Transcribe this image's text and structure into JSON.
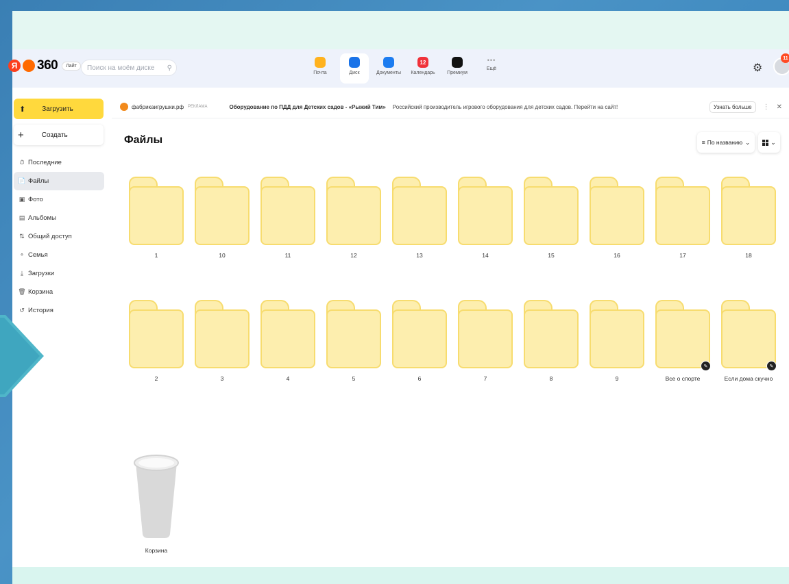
{
  "header": {
    "logo_ya": "Я",
    "logo_360": "360",
    "logo_lite": "Лайт",
    "search_placeholder": "Поиск на моём диске",
    "services": [
      {
        "label": "Почта",
        "color": "#ffb21e",
        "icon": "mail-icon"
      },
      {
        "label": "Диск",
        "color": "#1a73e8",
        "icon": "disk-icon",
        "active": true
      },
      {
        "label": "Документы",
        "color": "#1c7cf0",
        "icon": "docs-icon"
      },
      {
        "label": "Календарь",
        "color": "#f0323a",
        "icon": "calendar-icon",
        "badge": "12"
      },
      {
        "label": "Премиум",
        "color": "#111111",
        "icon": "premium-icon"
      },
      {
        "label": "Ещё",
        "color": "",
        "icon": "more-icon"
      }
    ],
    "notifications": "11"
  },
  "sidebar": {
    "upload_label": "Загрузить",
    "create_label": "Создать",
    "items": [
      {
        "label": "Последние",
        "icon": "clock-icon"
      },
      {
        "label": "Файлы",
        "icon": "file-icon",
        "active": true
      },
      {
        "label": "Фото",
        "icon": "photo-icon"
      },
      {
        "label": "Альбомы",
        "icon": "album-icon"
      },
      {
        "label": "Общий доступ",
        "icon": "share-icon"
      },
      {
        "label": "Семья",
        "icon": "family-icon"
      },
      {
        "label": "Загрузки",
        "icon": "download-icon"
      },
      {
        "label": "Корзина",
        "icon": "trash-icon"
      },
      {
        "label": "История",
        "icon": "history-icon"
      }
    ]
  },
  "ad": {
    "domain": "фабрикаигрушки.рф",
    "tag": "РЕКЛАМА",
    "title": "Оборудование по ПДД для Детских садов - «Рыжий Тим»",
    "text": "Российский производитель игрового оборудования для детских садов. Перейти на сайт!",
    "more_label": "Узнать больше"
  },
  "main": {
    "title": "Файлы",
    "sort_label": "По названию",
    "folders": [
      {
        "name": "1"
      },
      {
        "name": "10"
      },
      {
        "name": "11"
      },
      {
        "name": "12"
      },
      {
        "name": "13"
      },
      {
        "name": "14"
      },
      {
        "name": "15"
      },
      {
        "name": "16"
      },
      {
        "name": "17"
      },
      {
        "name": "18"
      },
      {
        "name": "2"
      },
      {
        "name": "3"
      },
      {
        "name": "4"
      },
      {
        "name": "5"
      },
      {
        "name": "6"
      },
      {
        "name": "7"
      },
      {
        "name": "8"
      },
      {
        "name": "9"
      },
      {
        "name": "Все о спорте",
        "shared": true
      },
      {
        "name": "Если дома скучно",
        "shared": true
      }
    ],
    "trash_label": "Корзина"
  },
  "colors": {
    "accent_yellow": "#ffd93d",
    "folder_fill": "#fdeeae",
    "folder_stroke": "#f7dc6f",
    "frame_bg": "#e4f7f2"
  }
}
